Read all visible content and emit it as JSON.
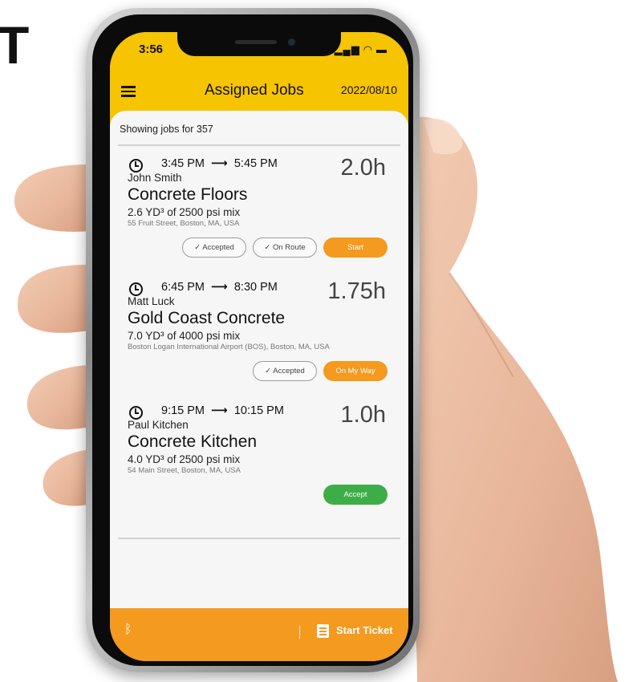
{
  "corner_letter": "T",
  "status_bar": {
    "time": "3:56",
    "icons": "▂▄▆ ◠ ▬"
  },
  "header": {
    "title": "Assigned Jobs",
    "date": "2022/08/10"
  },
  "showing_text": "Showing jobs for 357",
  "jobs": [
    {
      "start": "3:45 PM",
      "arrow": "⟶",
      "end": "5:45 PM",
      "duration": "2.0h",
      "customer": "John Smith",
      "name": "Concrete Floors",
      "mix": "2.6 YD³ of 2500 psi mix",
      "address": "55 Fruit Street, Boston, MA, USA",
      "actions": [
        "✓ Accepted",
        "✓ On Route",
        "Start"
      ]
    },
    {
      "start": "6:45 PM",
      "arrow": "⟶",
      "end": "8:30 PM",
      "duration": "1.75h",
      "customer": "Matt Luck",
      "name": "Gold Coast Concrete",
      "mix": "7.0 YD³ of 4000 psi mix",
      "address": "Boston Logan International Airport (BOS), Boston, MA, USA",
      "actions": [
        "✓ Accepted",
        "On My Way"
      ]
    },
    {
      "start": "9:15 PM",
      "arrow": "⟶",
      "end": "10:15 PM",
      "duration": "1.0h",
      "customer": "Paul Kitchen",
      "name": "Concrete Kitchen",
      "mix": "4.0 YD³ of 2500 psi mix",
      "address": "54 Main Street, Boston, MA, USA",
      "actions": [
        "Accept"
      ]
    }
  ],
  "bottom_bar": {
    "bluetooth_icon": "ᛒ",
    "start_ticket_label": "Start Ticket"
  },
  "colors": {
    "header_yellow": "#f6c400",
    "accent_orange": "#f39a1f",
    "accept_green": "#3dae47"
  },
  "icons": [
    "menu-icon",
    "clock-icon",
    "bluetooth-icon",
    "ticket-icon"
  ]
}
